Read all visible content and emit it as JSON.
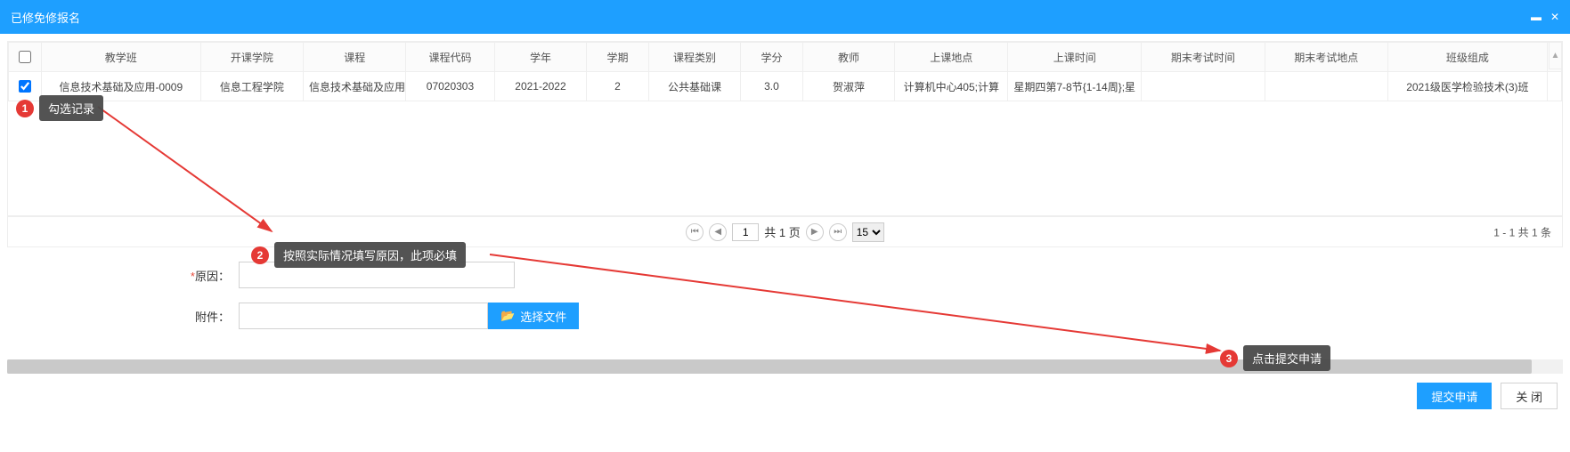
{
  "titlebar": {
    "title": "已修免修报名",
    "minimize_glyph": "▬",
    "close_glyph": "✕"
  },
  "table": {
    "headers": [
      "教学班",
      "开课学院",
      "课程",
      "课程代码",
      "学年",
      "学期",
      "课程类别",
      "学分",
      "教师",
      "上课地点",
      "上课时间",
      "期末考试时间",
      "期末考试地点",
      "班级组成"
    ],
    "row": {
      "checked": true,
      "cells": [
        "信息技术基础及应用-0009",
        "信息工程学院",
        "信息技术基础及应用",
        "07020303",
        "2021-2022",
        "2",
        "公共基础课",
        "3.0",
        "贺淑萍",
        "计算机中心405;计算",
        "星期四第7-8节{1-14周};星",
        "",
        "",
        "2021级医学检验技术(3)班"
      ]
    }
  },
  "pager": {
    "page_value": "1",
    "page_text": "共 1 页",
    "per_page": "15",
    "summary": "1 - 1   共 1 条",
    "glyph_first": "⏮",
    "glyph_prev": "◀",
    "glyph_next": "▶",
    "glyph_last": "⏭"
  },
  "form": {
    "reason_label": "原因：",
    "reason_asterisk": "*",
    "attach_label": "附件：",
    "choose_file": "选择文件",
    "folder_glyph": "📂"
  },
  "callouts": {
    "c1_num": "1",
    "c1_text": "勾选记录",
    "c2_num": "2",
    "c2_text": "按照实际情况填写原因，此项必填",
    "c3_num": "3",
    "c3_text": "点击提交申请"
  },
  "footer": {
    "submit": "提交申请",
    "close": "关 闭"
  }
}
